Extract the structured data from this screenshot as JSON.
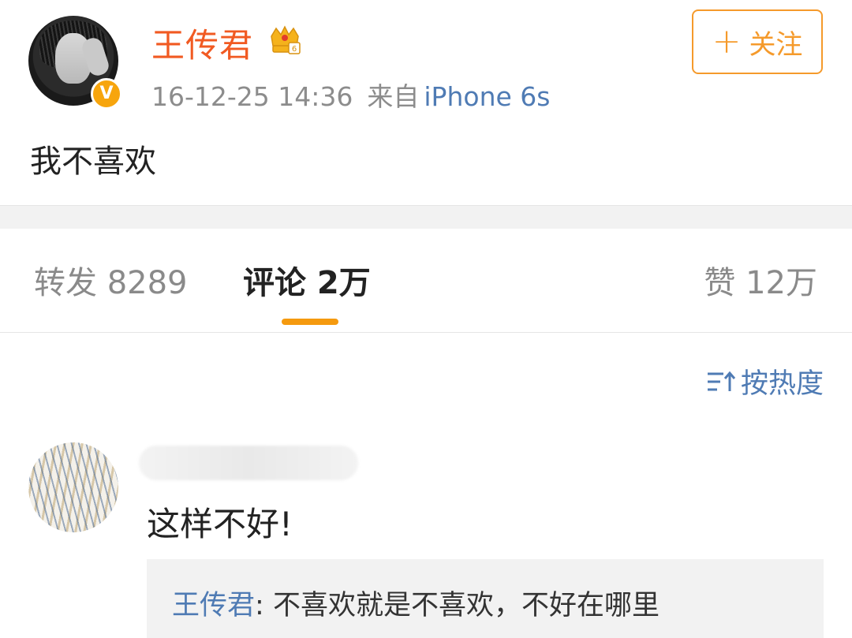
{
  "post": {
    "author": "王传君",
    "verified_badge": "V",
    "date": "16-12-25 14:36",
    "from_label": "来自",
    "device": "iPhone 6s",
    "follow_label": "关注",
    "follow_plus": "+",
    "text": "我不喜欢"
  },
  "tabs": {
    "repost": "转发 8289",
    "comment": "评论 2万",
    "like": "赞 12万"
  },
  "sort": {
    "label": "按热度"
  },
  "comment": {
    "text": "这样不好!",
    "reply": {
      "author": "王传君",
      "separator": ":",
      "text": " 不喜欢就是不喜欢，不好在哪里"
    }
  },
  "colors": {
    "author_orange": "#f15a22",
    "link_blue": "#4f7bb4",
    "accent_orange": "#f59a0f"
  },
  "icons": {
    "crown": "crown-icon",
    "verified": "verified-badge-icon",
    "plus": "plus-icon",
    "sort": "sort-icon"
  }
}
